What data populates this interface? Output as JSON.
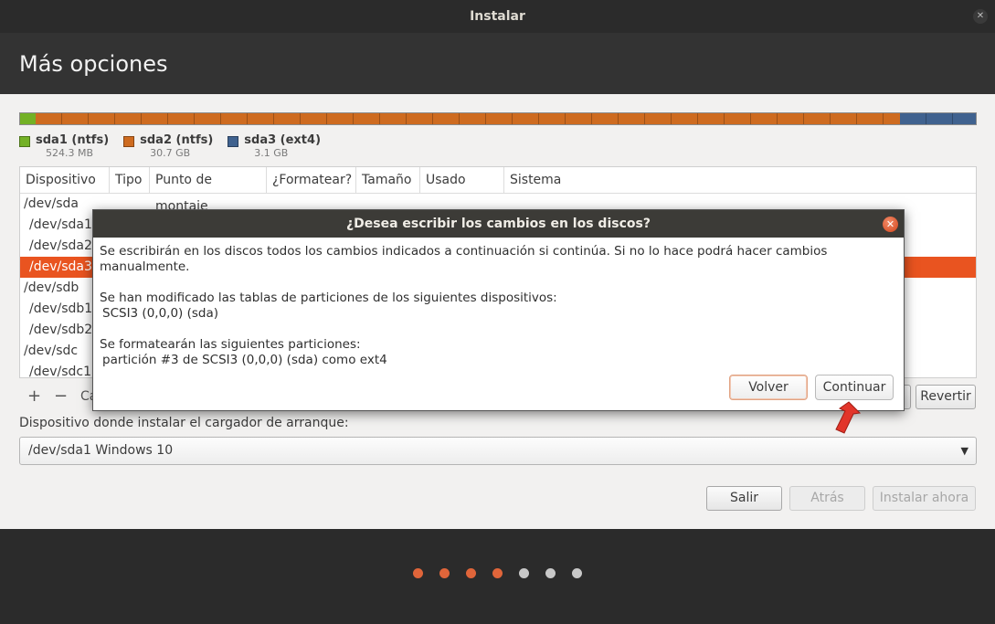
{
  "window": {
    "title": "Instalar"
  },
  "header": {
    "title": "Más opciones"
  },
  "disk_bar": {
    "segments": [
      {
        "name": "sda1 (ntfs)",
        "fraction": 0.016,
        "color": "#73b125"
      },
      {
        "name": "sda2 (ntfs)",
        "fraction": 0.905,
        "color": "#ce6b20"
      },
      {
        "name": "sda3 (ext4)",
        "fraction": 0.079,
        "color": "#40628f"
      }
    ]
  },
  "legend": [
    {
      "name": "sda1 (ntfs)",
      "size": "524.3 MB",
      "color": "#73b125"
    },
    {
      "name": "sda2 (ntfs)",
      "size": "30.7 GB",
      "color": "#ce6b20"
    },
    {
      "name": "sda3 (ext4)",
      "size": "3.1 GB",
      "color": "#40628f"
    }
  ],
  "table": {
    "columns": [
      "Dispositivo",
      "Tipo",
      "Punto de montaje",
      "¿Formatear?",
      "Tamaño",
      "Usado",
      "Sistema"
    ],
    "rows": [
      "/dev/sda",
      "/dev/sda1",
      "/dev/sda2",
      "/dev/sda3",
      "/dev/sdb",
      "/dev/sdb1",
      "/dev/sdb2",
      "/dev/sdc",
      "/dev/sdc1"
    ],
    "selected_row": "/dev/sda3"
  },
  "table_tools": {
    "add": "+",
    "remove": "−",
    "change_partial": "Ca",
    "more": "..",
    "revert": "Revertir"
  },
  "bootloader": {
    "label": "Dispositivo donde instalar el cargador de arranque:",
    "value": "/dev/sda1 Windows 10"
  },
  "nav_buttons": {
    "quit": "Salir",
    "back": "Atrás",
    "install": "Instalar ahora"
  },
  "progress_dots": {
    "total": 7,
    "completed": 4,
    "active_color": "#e0653a",
    "inactive_color": "#c8c8c8"
  },
  "dialog": {
    "title": "¿Desea escribir los cambios en los discos?",
    "line1": "Se escribirán en los discos todos los cambios indicados a continuación si continúa. Si no lo hace podrá hacer cambios manualmente.",
    "line2": "Se han modificado las tablas de particiones de los siguientes dispositivos:",
    "line3": "SCSI3 (0,0,0) (sda)",
    "line4": "Se formatearán las siguientes particiones:",
    "line5": "partición #3 de SCSI3 (0,0,0) (sda) como ext4",
    "back_button": "Volver",
    "continue_button": "Continuar"
  },
  "colors": {
    "accent": "#e95420"
  }
}
